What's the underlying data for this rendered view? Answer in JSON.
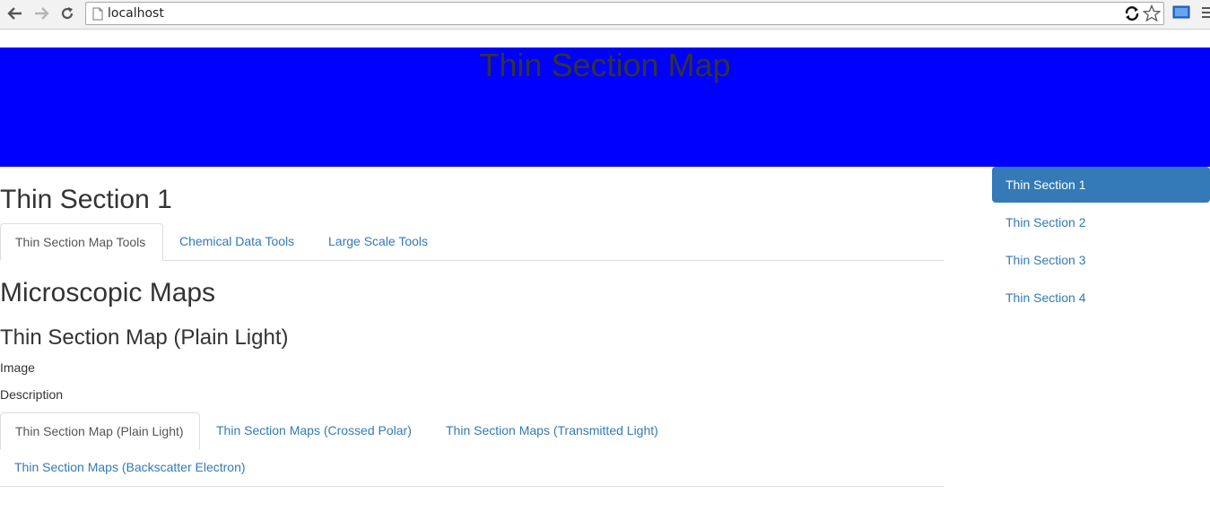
{
  "browser": {
    "url": "localhost",
    "icons": {
      "back": "arrow-left-icon",
      "forward": "arrow-right-icon",
      "reload": "reload-icon",
      "page": "page-icon",
      "extension": "sync-icon",
      "bookmark": "star-icon",
      "cast": "cast-icon",
      "menu": "hamburger-menu-icon"
    }
  },
  "banner": {
    "title": "Thin Section Map",
    "background_color": "#0000ff"
  },
  "main": {
    "page_title": "Thin Section 1",
    "top_tabs": [
      {
        "label": "Thin Section Map Tools",
        "active": true
      },
      {
        "label": "Chemical Data Tools",
        "active": false
      },
      {
        "label": "Large Scale Tools",
        "active": false
      }
    ],
    "section_title": "Microscopic Maps",
    "subsection_title": "Thin Section Map (Plain Light)",
    "image_label": "Image",
    "description_label": "Description",
    "map_tabs": [
      {
        "label": "Thin Section Map (Plain Light)",
        "active": true
      },
      {
        "label": "Thin Section Maps (Crossed Polar)",
        "active": false
      },
      {
        "label": "Thin Section Maps (Transmitted Light)",
        "active": false
      },
      {
        "label": "Thin Section Maps (Backscatter Electron)",
        "active": false
      }
    ]
  },
  "sidebar": {
    "items": [
      {
        "label": "Thin Section 1",
        "active": true
      },
      {
        "label": "Thin Section 2",
        "active": false
      },
      {
        "label": "Thin Section 3",
        "active": false
      },
      {
        "label": "Thin Section 4",
        "active": false
      }
    ],
    "accent_color": "#337ab7"
  }
}
